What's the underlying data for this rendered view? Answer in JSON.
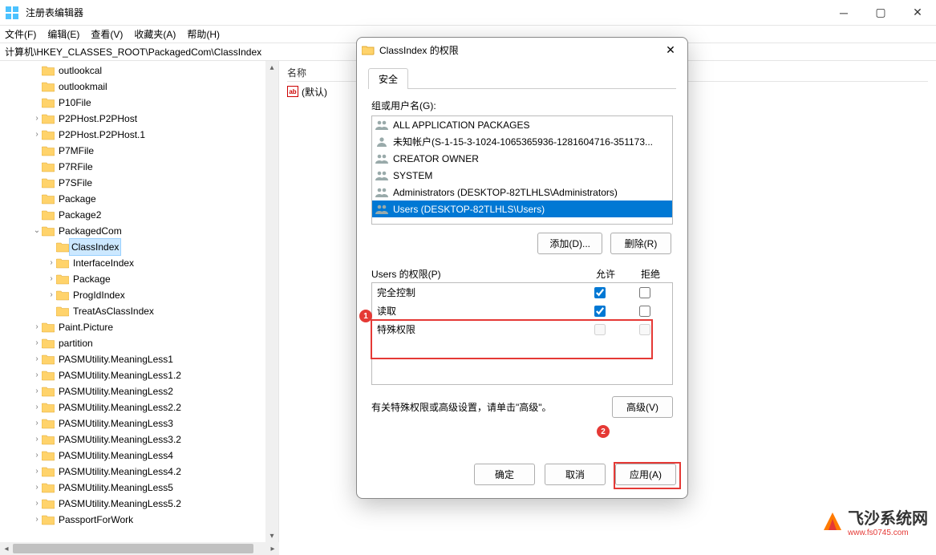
{
  "window": {
    "title": "注册表编辑器"
  },
  "menu": {
    "file": "文件(F)",
    "edit": "编辑(E)",
    "view": "查看(V)",
    "favorites": "收藏夹(A)",
    "help": "帮助(H)"
  },
  "address": "计算机\\HKEY_CLASSES_ROOT\\PackagedCom\\ClassIndex",
  "tree": [
    {
      "indent": 2,
      "exp": "",
      "label": "outlookcal"
    },
    {
      "indent": 2,
      "exp": "",
      "label": "outlookmail"
    },
    {
      "indent": 2,
      "exp": "",
      "label": "P10File"
    },
    {
      "indent": 2,
      "exp": ">",
      "label": "P2PHost.P2PHost"
    },
    {
      "indent": 2,
      "exp": ">",
      "label": "P2PHost.P2PHost.1"
    },
    {
      "indent": 2,
      "exp": "",
      "label": "P7MFile"
    },
    {
      "indent": 2,
      "exp": "",
      "label": "P7RFile"
    },
    {
      "indent": 2,
      "exp": "",
      "label": "P7SFile"
    },
    {
      "indent": 2,
      "exp": "",
      "label": "Package"
    },
    {
      "indent": 2,
      "exp": "",
      "label": "Package2"
    },
    {
      "indent": 2,
      "exp": "v",
      "label": "PackagedCom"
    },
    {
      "indent": 3,
      "exp": "",
      "label": "ClassIndex",
      "selected": true
    },
    {
      "indent": 3,
      "exp": ">",
      "label": "InterfaceIndex"
    },
    {
      "indent": 3,
      "exp": ">",
      "label": "Package"
    },
    {
      "indent": 3,
      "exp": ">",
      "label": "ProgIdIndex"
    },
    {
      "indent": 3,
      "exp": "",
      "label": "TreatAsClassIndex"
    },
    {
      "indent": 2,
      "exp": ">",
      "label": "Paint.Picture"
    },
    {
      "indent": 2,
      "exp": ">",
      "label": "partition"
    },
    {
      "indent": 2,
      "exp": ">",
      "label": "PASMUtility.MeaningLess1"
    },
    {
      "indent": 2,
      "exp": ">",
      "label": "PASMUtility.MeaningLess1.2"
    },
    {
      "indent": 2,
      "exp": ">",
      "label": "PASMUtility.MeaningLess2"
    },
    {
      "indent": 2,
      "exp": ">",
      "label": "PASMUtility.MeaningLess2.2"
    },
    {
      "indent": 2,
      "exp": ">",
      "label": "PASMUtility.MeaningLess3"
    },
    {
      "indent": 2,
      "exp": ">",
      "label": "PASMUtility.MeaningLess3.2"
    },
    {
      "indent": 2,
      "exp": ">",
      "label": "PASMUtility.MeaningLess4"
    },
    {
      "indent": 2,
      "exp": ">",
      "label": "PASMUtility.MeaningLess4.2"
    },
    {
      "indent": 2,
      "exp": ">",
      "label": "PASMUtility.MeaningLess5"
    },
    {
      "indent": 2,
      "exp": ">",
      "label": "PASMUtility.MeaningLess5.2"
    },
    {
      "indent": 2,
      "exp": ">",
      "label": "PassportForWork"
    }
  ],
  "list": {
    "col_name": "名称",
    "default_value": "(默认)"
  },
  "dialog": {
    "title": "ClassIndex 的权限",
    "tab": "安全",
    "groups_label": "组或用户名(G):",
    "users": [
      {
        "icon": "group",
        "text": "ALL APPLICATION PACKAGES"
      },
      {
        "icon": "user",
        "text": "未知帐户(S-1-15-3-1024-1065365936-1281604716-351173..."
      },
      {
        "icon": "group",
        "text": "CREATOR OWNER"
      },
      {
        "icon": "group",
        "text": "SYSTEM"
      },
      {
        "icon": "group",
        "text": "Administrators (DESKTOP-82TLHLS\\Administrators)"
      },
      {
        "icon": "group",
        "text": "Users (DESKTOP-82TLHLS\\Users)",
        "selected": true
      }
    ],
    "add": "添加(D)...",
    "remove": "删除(R)",
    "perm_for": "Users 的权限(P)",
    "col_allow": "允许",
    "col_deny": "拒绝",
    "perms": [
      {
        "name": "完全控制",
        "allow": true,
        "deny": false
      },
      {
        "name": "读取",
        "allow": true,
        "deny": false
      },
      {
        "name": "特殊权限",
        "allow": false,
        "deny": false,
        "disabled": true
      }
    ],
    "adv_text": "有关特殊权限或高级设置，请单击\"高级\"。",
    "adv_btn": "高级(V)",
    "ok": "确定",
    "cancel": "取消",
    "apply": "应用(A)"
  },
  "annotations": {
    "badge1": "1",
    "badge2": "2"
  },
  "watermark": {
    "big": "飞沙系统网",
    "small": "www.fs0745.com"
  }
}
